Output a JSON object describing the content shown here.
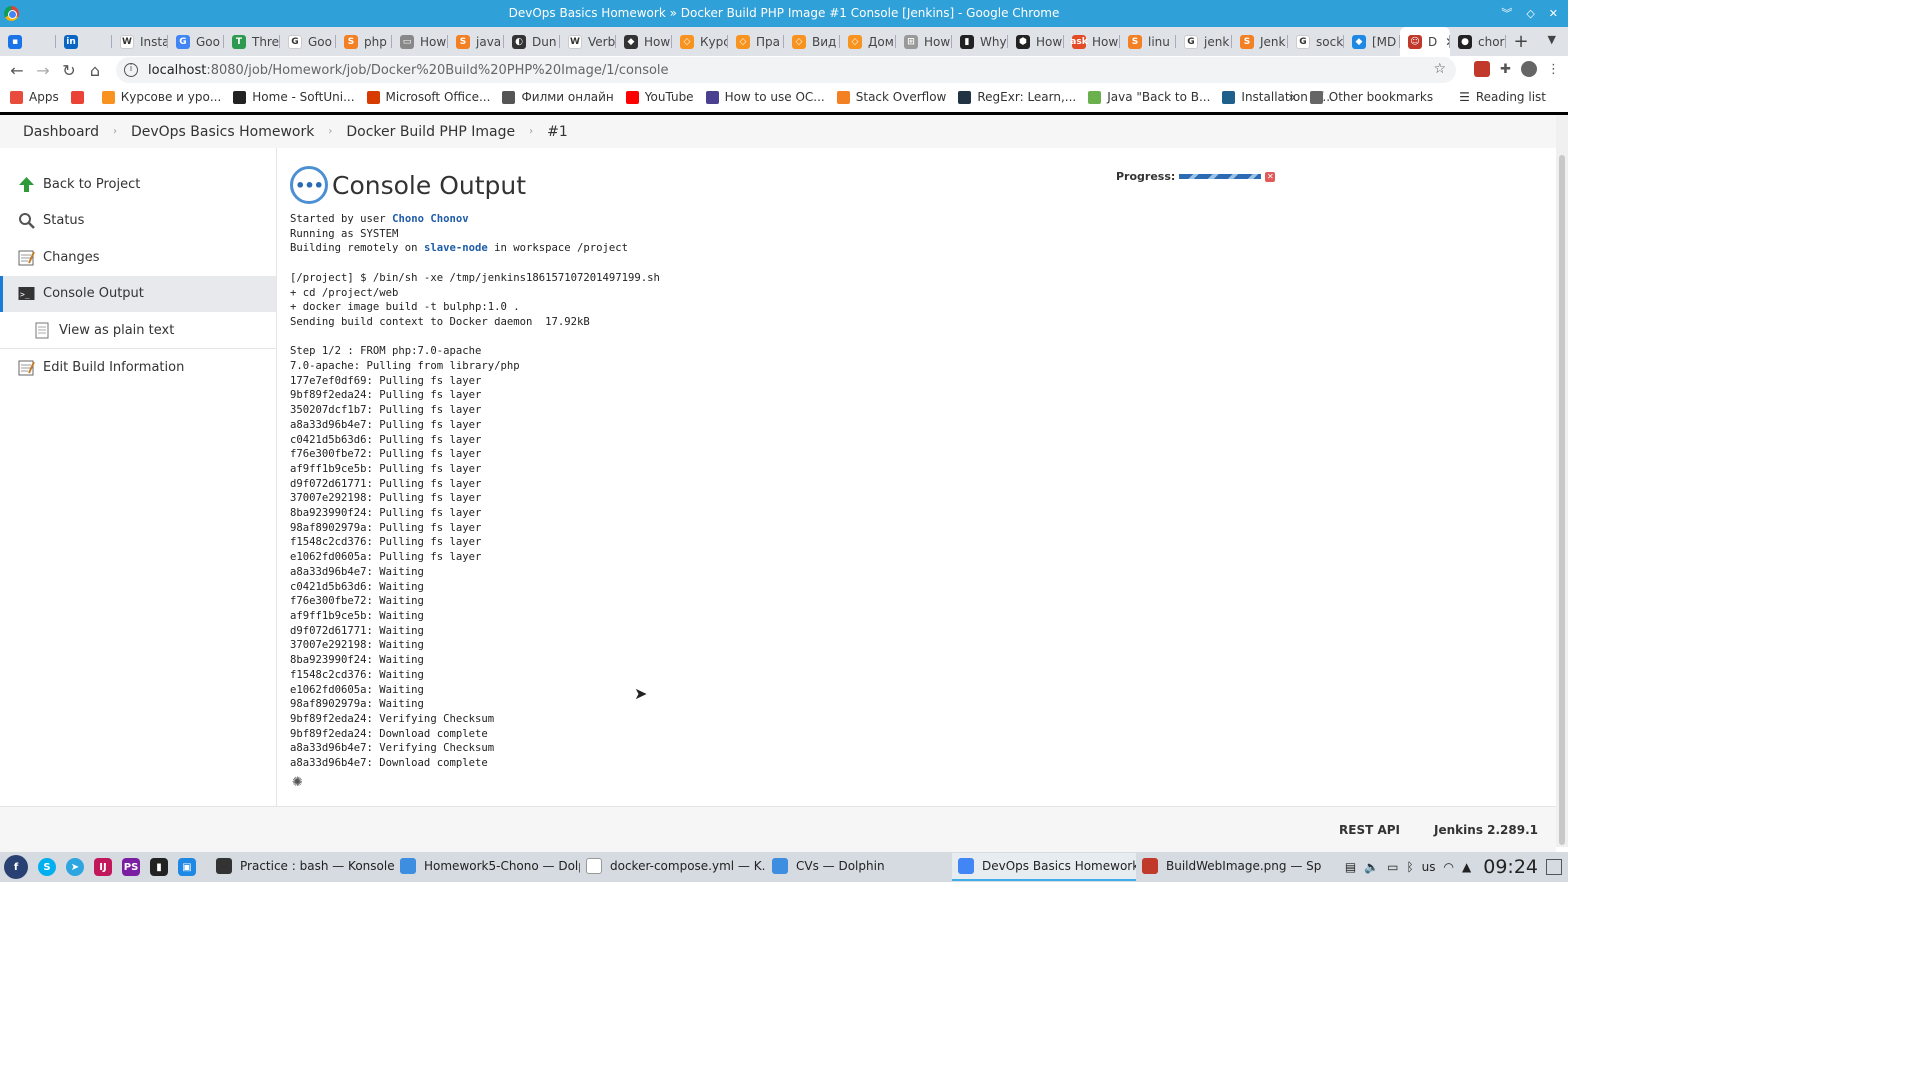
{
  "window": {
    "title": "DevOps Basics Homework » Docker Build PHP Image #1 Console [Jenkins] - Google Chrome"
  },
  "tabs": [
    {
      "label": "",
      "color": "#1a73e8",
      "glyph": "▪"
    },
    {
      "label": "",
      "color": "#0a66c2",
      "glyph": "in"
    },
    {
      "label": "Insta",
      "color": "#ffffff",
      "glyph": "W"
    },
    {
      "label": "Goo",
      "color": "#4285f4",
      "glyph": "G"
    },
    {
      "label": "Thre",
      "color": "#2e9a4f",
      "glyph": "T"
    },
    {
      "label": "Goo",
      "color": "#ffffff",
      "glyph": "G"
    },
    {
      "label": "php",
      "color": "#f48024",
      "glyph": "S"
    },
    {
      "label": "How",
      "color": "#888888",
      "glyph": "▭"
    },
    {
      "label": "java",
      "color": "#f48024",
      "glyph": "S"
    },
    {
      "label": "Dun",
      "color": "#333333",
      "glyph": "◐"
    },
    {
      "label": "Verb",
      "color": "#ffffff",
      "glyph": "W"
    },
    {
      "label": "How",
      "color": "#333333",
      "glyph": "◆"
    },
    {
      "label": "Курс",
      "color": "#f7931e",
      "glyph": "◇"
    },
    {
      "label": "Пра",
      "color": "#f7931e",
      "glyph": "◇"
    },
    {
      "label": "Вид",
      "color": "#f7931e",
      "glyph": "◇"
    },
    {
      "label": "Дом",
      "color": "#f7931e",
      "glyph": "◇"
    },
    {
      "label": "How",
      "color": "#999999",
      "glyph": "⊞"
    },
    {
      "label": "Why",
      "color": "#222222",
      "glyph": "▮"
    },
    {
      "label": "How",
      "color": "#222222",
      "glyph": "⬢"
    },
    {
      "label": "How",
      "color": "#e34c26",
      "glyph": "ask"
    },
    {
      "label": "linu",
      "color": "#f48024",
      "glyph": "S"
    },
    {
      "label": "jenk",
      "color": "#ffffff",
      "glyph": "G"
    },
    {
      "label": "Jenk",
      "color": "#f48024",
      "glyph": "S"
    },
    {
      "label": "sock",
      "color": "#ffffff",
      "glyph": "G"
    },
    {
      "label": "[MD",
      "color": "#1e88e5",
      "glyph": "◆"
    },
    {
      "label": "D",
      "color": "#c0392b",
      "glyph": "☺",
      "active": true
    },
    {
      "label": "chor",
      "color": "#222222",
      "glyph": "●"
    }
  ],
  "toolbar": {
    "url_host": "localhost",
    "url_path": ":8080/job/Homework/job/Docker%20Build%20PHP%20Image/1/console"
  },
  "bookmarks": [
    {
      "label": "Apps",
      "color": "#e74c3c"
    },
    {
      "label": "",
      "color": "#ea4335"
    },
    {
      "label": "Курсове и уро...",
      "color": "#f7931e"
    },
    {
      "label": "Home - SoftUni...",
      "color": "#222222"
    },
    {
      "label": "Microsoft Office...",
      "color": "#d83b01"
    },
    {
      "label": "Филми онлайн",
      "color": "#555555"
    },
    {
      "label": "YouTube",
      "color": "#ff0000"
    },
    {
      "label": "How to use OC...",
      "color": "#4b3f8f"
    },
    {
      "label": "Stack Overflow",
      "color": "#f48024"
    },
    {
      "label": "RegExr: Learn,...",
      "color": "#223344"
    },
    {
      "label": "Java \"Back to B...",
      "color": "#6ab04c"
    },
    {
      "label": "Installation of...",
      "color": "#1f5f8b"
    }
  ],
  "bookmarks_right": {
    "more": "»",
    "other": "Other bookmarks",
    "reading": "Reading list"
  },
  "breadcrumbs": [
    "Dashboard",
    "DevOps Basics Homework",
    "Docker Build PHP Image",
    "#1"
  ],
  "sidebar": [
    {
      "label": "Back to Project",
      "icon": "up-arrow-icon"
    },
    {
      "label": "Status",
      "icon": "magnifier-icon"
    },
    {
      "label": "Changes",
      "icon": "notepad-icon"
    },
    {
      "label": "Console Output",
      "icon": "terminal-icon",
      "active": true
    },
    {
      "label": "View as plain text",
      "icon": "document-icon",
      "sub": true
    },
    {
      "label": "Edit Build Information",
      "icon": "notepad-icon"
    }
  ],
  "main": {
    "title": "Console Output",
    "progress_label": "Progress:",
    "progress_fraction": 0.5
  },
  "console": {
    "started_prefix": "Started by user ",
    "user": "Chono Chonov",
    "running": "Running as SYSTEM",
    "building_prefix": "Building remotely on ",
    "node": "slave-node",
    "building_suffix": " in workspace /project",
    "lines": [
      "[/project] $ /bin/sh -xe /tmp/jenkins186157107201497199.sh",
      "+ cd /project/web",
      "+ docker image build -t bulphp:1.0 .",
      "Sending build context to Docker daemon  17.92kB",
      "",
      "Step 1/2 : FROM php:7.0-apache",
      "7.0-apache: Pulling from library/php",
      "177e7ef0df69: Pulling fs layer",
      "9bf89f2eda24: Pulling fs layer",
      "350207dcf1b7: Pulling fs layer",
      "a8a33d96b4e7: Pulling fs layer",
      "c0421d5b63d6: Pulling fs layer",
      "f76e300fbe72: Pulling fs layer",
      "af9ff1b9ce5b: Pulling fs layer",
      "d9f072d61771: Pulling fs layer",
      "37007e292198: Pulling fs layer",
      "8ba923990f24: Pulling fs layer",
      "98af8902979a: Pulling fs layer",
      "f1548c2cd376: Pulling fs layer",
      "e1062fd0605a: Pulling fs layer",
      "a8a33d96b4e7: Waiting",
      "c0421d5b63d6: Waiting",
      "f76e300fbe72: Waiting",
      "af9ff1b9ce5b: Waiting",
      "d9f072d61771: Waiting",
      "37007e292198: Waiting",
      "8ba923990f24: Waiting",
      "f1548c2cd376: Waiting",
      "e1062fd0605a: Waiting",
      "98af8902979a: Waiting",
      "9bf89f2eda24: Verifying Checksum",
      "9bf89f2eda24: Download complete",
      "a8a33d96b4e7: Verifying Checksum",
      "a8a33d96b4e7: Download complete"
    ]
  },
  "footer": {
    "rest_api": "REST API",
    "version": "Jenkins 2.289.1"
  },
  "taskbar": {
    "tasks": [
      {
        "label": "Practice : bash — Konsole",
        "color": "#333333"
      },
      {
        "label": "Homework5-Chono — Dolp...",
        "color": "#3d8ee0"
      },
      {
        "label": "docker-compose.yml  — K...",
        "color": "#ffffff"
      },
      {
        "label": "CVs — Dolphin",
        "color": "#3d8ee0"
      },
      {
        "label": "DevOps Basics Homework ...",
        "color": "#4285f4",
        "active": true
      },
      {
        "label": "BuildWebImage.png — Spe...",
        "color": "#c0392b"
      }
    ],
    "keyboard": "us",
    "clock": "09:24"
  }
}
